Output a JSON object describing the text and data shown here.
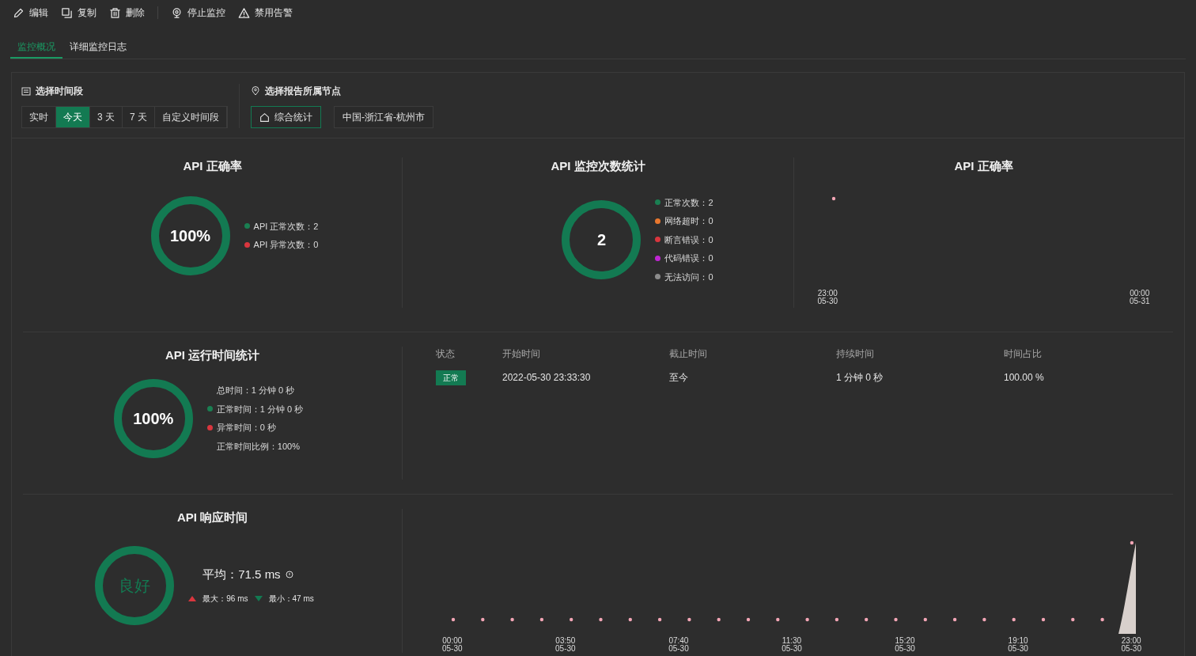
{
  "toolbar": [
    {
      "kind": "edit",
      "label": "编辑"
    },
    {
      "kind": "copy",
      "label": "复制"
    },
    {
      "kind": "delete",
      "label": "删除"
    },
    {
      "kind": "monitor",
      "label": "停止监控"
    },
    {
      "kind": "warning",
      "label": "禁用告警"
    }
  ],
  "tabs": [
    {
      "label": "监控概况",
      "selected": true
    },
    {
      "label": "详细监控日志",
      "selected": false
    }
  ],
  "time_range": {
    "title": "选择时间段",
    "options": [
      {
        "label": "实时",
        "selected": false
      },
      {
        "label": "今天",
        "selected": true
      },
      {
        "label": "3 天",
        "selected": false
      },
      {
        "label": "7 天",
        "selected": false
      },
      {
        "label": "自定义时间段",
        "selected": false
      }
    ]
  },
  "nodes": {
    "title": "选择报告所属节点",
    "options": [
      {
        "label": "综合统计",
        "selected": true,
        "home": true
      },
      {
        "label": "中国-浙江省-杭州市",
        "selected": false,
        "home": false
      }
    ]
  },
  "accuracy": {
    "title": "API 正确率",
    "value": "100%",
    "legend": [
      {
        "label": "API 正常次数：2",
        "color": "#1a7f52"
      },
      {
        "label": "API 异常次数：0",
        "color": "#d9363e"
      }
    ]
  },
  "counts": {
    "title": "API 监控次数统计",
    "value": "2",
    "legend": [
      {
        "label": "正常次数：2",
        "color": "#1a7f52"
      },
      {
        "label": "网络超时：0",
        "color": "#e8772e"
      },
      {
        "label": "断言错误：0",
        "color": "#d9363e"
      },
      {
        "label": "代码错误：0",
        "color": "#c026d3"
      },
      {
        "label": "无法访问：0",
        "color": "#8c8c8c"
      }
    ]
  },
  "accuracy_chart": {
    "title": "API 正确率",
    "x_labels": [
      {
        "time": "23:00",
        "date": "05-30"
      },
      {
        "time": "00:00",
        "date": "05-31"
      }
    ]
  },
  "runtime": {
    "title": "API 运行时间统计",
    "value": "100%",
    "legend": [
      {
        "label": "总时间：1 分钟 0 秒"
      },
      {
        "label": "正常时间：1 分钟 0 秒",
        "color": "#1a7f52"
      },
      {
        "label": "异常时间：0 秒",
        "color": "#d9363e"
      },
      {
        "label": "正常时间比例：100%"
      }
    ]
  },
  "runtime_table": {
    "columns": [
      "状态",
      "开始时间",
      "截止时间",
      "持续时间",
      "时间占比"
    ],
    "rows": [
      {
        "status": "正常",
        "start": "2022-05-30 23:33:30",
        "end": "至今",
        "duration": "1 分钟 0 秒",
        "share": "100.00 %"
      }
    ]
  },
  "response": {
    "title": "API 响应时间",
    "rating": "良好",
    "average": "平均：71.5 ms",
    "max": "最大：96 ms",
    "min": "最小：47 ms"
  },
  "response_chart": {
    "x_labels": [
      {
        "time": "00:00",
        "date": "05-30"
      },
      {
        "time": "03:50",
        "date": "05-30"
      },
      {
        "time": "07:40",
        "date": "05-30"
      },
      {
        "time": "11:30",
        "date": "05-30"
      },
      {
        "time": "15:20",
        "date": "05-30"
      },
      {
        "time": "19:10",
        "date": "05-30"
      },
      {
        "time": "23:00",
        "date": "05-30"
      }
    ]
  }
}
